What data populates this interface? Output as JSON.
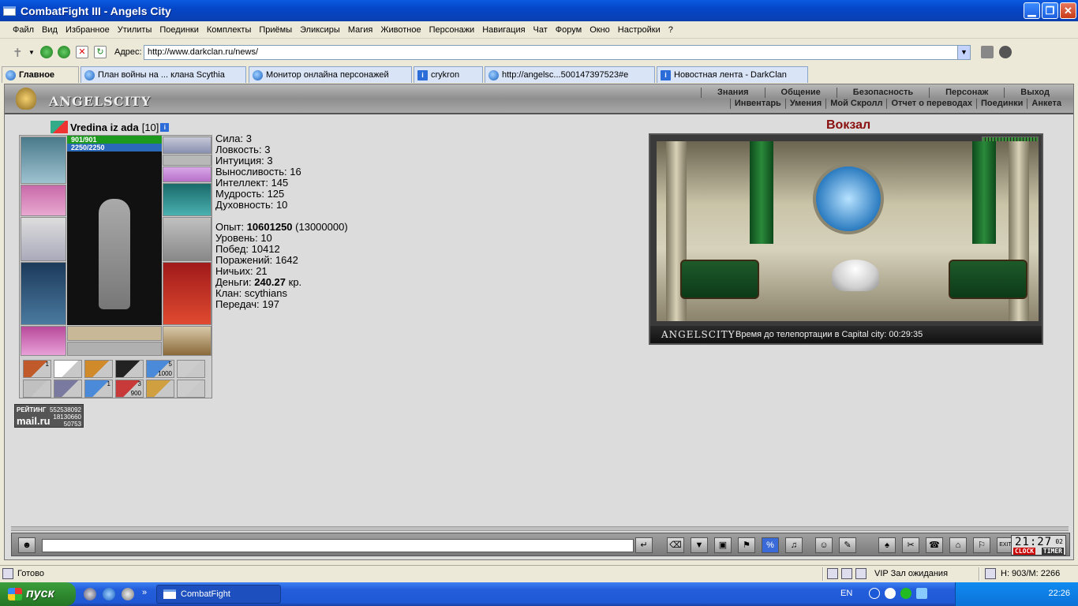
{
  "window": {
    "title": "CombatFight III - Angels City",
    "minimize_icon": "minimize-icon",
    "maximize_icon": "maximize-icon",
    "close_icon": "close-icon"
  },
  "menu": {
    "items": [
      "Файл",
      "Вид",
      "Избранное",
      "Утилиты",
      "Поединки",
      "Комплекты",
      "Приёмы",
      "Эликсиры",
      "Магия",
      "Животное",
      "Персонажи",
      "Навигация",
      "Чат",
      "Форум",
      "Окно",
      "Настройки",
      "?"
    ]
  },
  "address": {
    "label": "Адрес:",
    "url": "http://www.darkclan.ru/news/"
  },
  "tabs": [
    {
      "label": "Главное",
      "icon": "globe-icon",
      "active": true
    },
    {
      "label": "План войны на ... клана Scythia",
      "icon": "ie-icon"
    },
    {
      "label": "Монитор онлайна персонажей",
      "icon": "ie-icon"
    },
    {
      "label": "crykron",
      "icon": "info-icon"
    },
    {
      "label": "http://angelsc...500147397523#e",
      "icon": "ie-icon"
    },
    {
      "label": "Новостная лента - DarkClan",
      "icon": "info-icon"
    }
  ],
  "game": {
    "logo": "ANGELSCITY",
    "nav_main": [
      "Знания",
      "Общение",
      "Безопасность",
      "Персонаж",
      "Выход"
    ],
    "nav_sub": [
      "Инвентарь",
      "Умения",
      "Мой Скролл",
      "Отчет о переводах",
      "Поединки",
      "Анкета"
    ],
    "character": {
      "name": "Vredina iz ada",
      "level": "[10]",
      "hp": "901/901",
      "mp": "2250/2250",
      "hp_fraction": 1.0,
      "mp_fraction": 1.0
    },
    "stats": [
      {
        "label": "Сила:",
        "value": "3"
      },
      {
        "label": "Ловкость:",
        "value": "3"
      },
      {
        "label": "Интуиция:",
        "value": "3"
      },
      {
        "label": "Выносливость:",
        "value": "16"
      },
      {
        "label": "Интеллект:",
        "value": "145"
      },
      {
        "label": "Мудрость:",
        "value": "125"
      },
      {
        "label": "Духовность:",
        "value": "10"
      }
    ],
    "stats2": {
      "exp_label": "Опыт:",
      "exp_value": "10601250",
      "exp_next": "(13000000)",
      "level_label": "Уровень:",
      "level_value": "10",
      "wins_label": "Побед:",
      "wins_value": "10412",
      "losses_label": "Поражений:",
      "losses_value": "1642",
      "draws_label": "Ничьих:",
      "draws_value": "21",
      "money_label": "Деньги:",
      "money_value": "240.27",
      "money_unit": "кр.",
      "clan_label": "Клан:",
      "clan_value": "scythians",
      "transfers_label": "Передач:",
      "transfers_value": "197"
    },
    "quick_slots": [
      {
        "badge": "1"
      },
      {
        "badge": ""
      },
      {
        "badge": ""
      },
      {
        "badge": ""
      },
      {
        "badge": "5",
        "sub": "1000"
      },
      {
        "badge": ""
      },
      {
        "badge": ""
      },
      {
        "badge": ""
      },
      {
        "badge": "1"
      },
      {
        "badge": "3",
        "sub": "900"
      },
      {
        "badge": ""
      },
      {
        "badge": ""
      }
    ],
    "rating": {
      "label": "РЕЙТИНГ",
      "brand": "mail.ru",
      "n1": "552538092",
      "n2": "18130660",
      "n3": "50753"
    },
    "location": {
      "title": "Вокзал",
      "brand": "ANGELSCITY",
      "teleport": "Время до телепортации в Capital city: 00:29:35"
    },
    "chat": {
      "clock_time": "21:27",
      "clock_sec": "02",
      "clock_label": "CLOCK",
      "timer_label": "TIMER",
      "exit_label": "EXIT"
    }
  },
  "status": {
    "text": "Готово",
    "vip": "VIP Зал ожидания",
    "hm": "H: 903/M: 2266"
  },
  "taskbar": {
    "start": "пуск",
    "item": "CombatFight",
    "lang": "EN",
    "time": "22:26"
  }
}
